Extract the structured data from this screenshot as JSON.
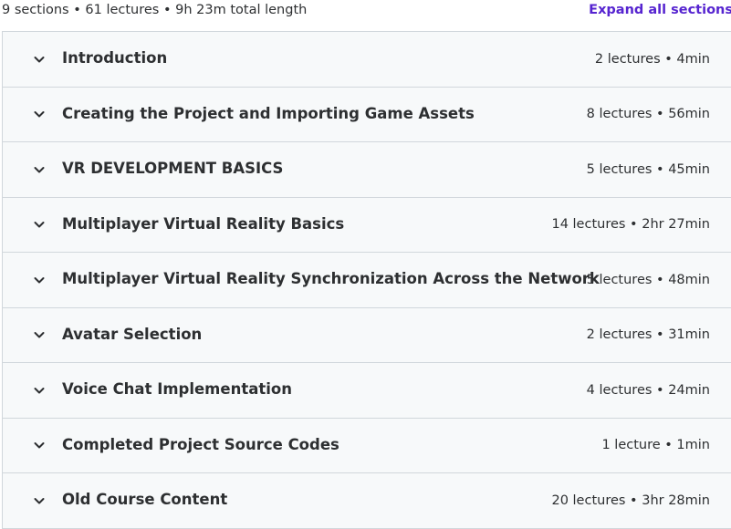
{
  "curriculum": {
    "summary": "9 sections • 61 lectures • 9h 23m total length",
    "expand_all_label": "Expand all sections",
    "sections": [
      {
        "title": "Introduction",
        "meta": "2 lectures • 4min"
      },
      {
        "title": "Creating the Project and Importing Game Assets",
        "meta": "8 lectures • 56min"
      },
      {
        "title": "VR DEVELOPMENT BASICS",
        "meta": "5 lectures • 45min"
      },
      {
        "title": "Multiplayer Virtual Reality Basics",
        "meta": "14 lectures • 2hr 27min"
      },
      {
        "title": "Multiplayer Virtual Reality Synchronization Across the Network",
        "meta": "5 lectures • 48min"
      },
      {
        "title": "Avatar Selection",
        "meta": "2 lectures • 31min"
      },
      {
        "title": "Voice Chat Implementation",
        "meta": "4 lectures • 24min"
      },
      {
        "title": "Completed Project Source Codes",
        "meta": "1 lecture • 1min"
      },
      {
        "title": "Old Course Content",
        "meta": "20 lectures • 3hr 28min"
      }
    ]
  },
  "icons": {
    "section_toggle": "chevron-down-icon"
  },
  "colors": {
    "accent": "#5624d0",
    "text": "#2d2f31",
    "section_bg": "#f7f9fa",
    "border": "#d1d7dc"
  }
}
